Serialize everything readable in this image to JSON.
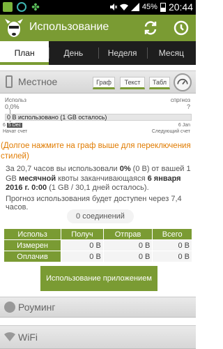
{
  "status_bar": {
    "battery": "45%",
    "time": "20:44"
  },
  "app": {
    "title": "Использование",
    "accent_color": "#7a9b33"
  },
  "tabs": [
    {
      "label": "План",
      "active": true
    },
    {
      "label": "День",
      "active": false
    },
    {
      "label": "Неделя",
      "active": false
    },
    {
      "label": "Месяц",
      "active": false
    }
  ],
  "local_section": {
    "title": "Местное",
    "view_buttons": {
      "graph": "Граф",
      "text": "Текст",
      "table": "Табл"
    },
    "graph": {
      "used_label": "Использ",
      "used_percent": "0,0%",
      "forecast_label": "спргноз",
      "forecast_value": "?",
      "bar_text": "0 В использовано (1 GB осталось)",
      "start_prefix": "6",
      "start_date": "5 Dec",
      "end_date": "6 Jan",
      "start_label": "Начат счет",
      "end_label": "Следующий счет"
    },
    "hint": "(Долгое нажмите на граф выше для переключения стилей)",
    "description": {
      "p1": "За 20,7 часов вы использовали ",
      "pct": "0%",
      "p2": " (0 В) от вашей 1 GB ",
      "monthly": "месячной",
      "p3": " квоты заканчивающаяся ",
      "date": "6 января 2016 г. 0:00",
      "p4": " (1 GB / 30,1 дней осталось)."
    },
    "forecast_note": "Прогноз использования будет доступен через 7,4 часов.",
    "connections": "0 соединений"
  },
  "usage_table": {
    "headers": [
      "Использ",
      "Получ",
      "Отправ",
      "Всего"
    ],
    "rows": [
      {
        "label": "Измерен",
        "values": [
          "0 В",
          "0 В",
          "0 В"
        ]
      },
      {
        "label": "Оплачив",
        "values": [
          "0 В",
          "0 В",
          "0 В"
        ]
      }
    ]
  },
  "app_usage_button": "Использование приложением",
  "roaming_section": {
    "title": "Роуминг"
  },
  "wifi_section": {
    "title": "WiFi"
  }
}
